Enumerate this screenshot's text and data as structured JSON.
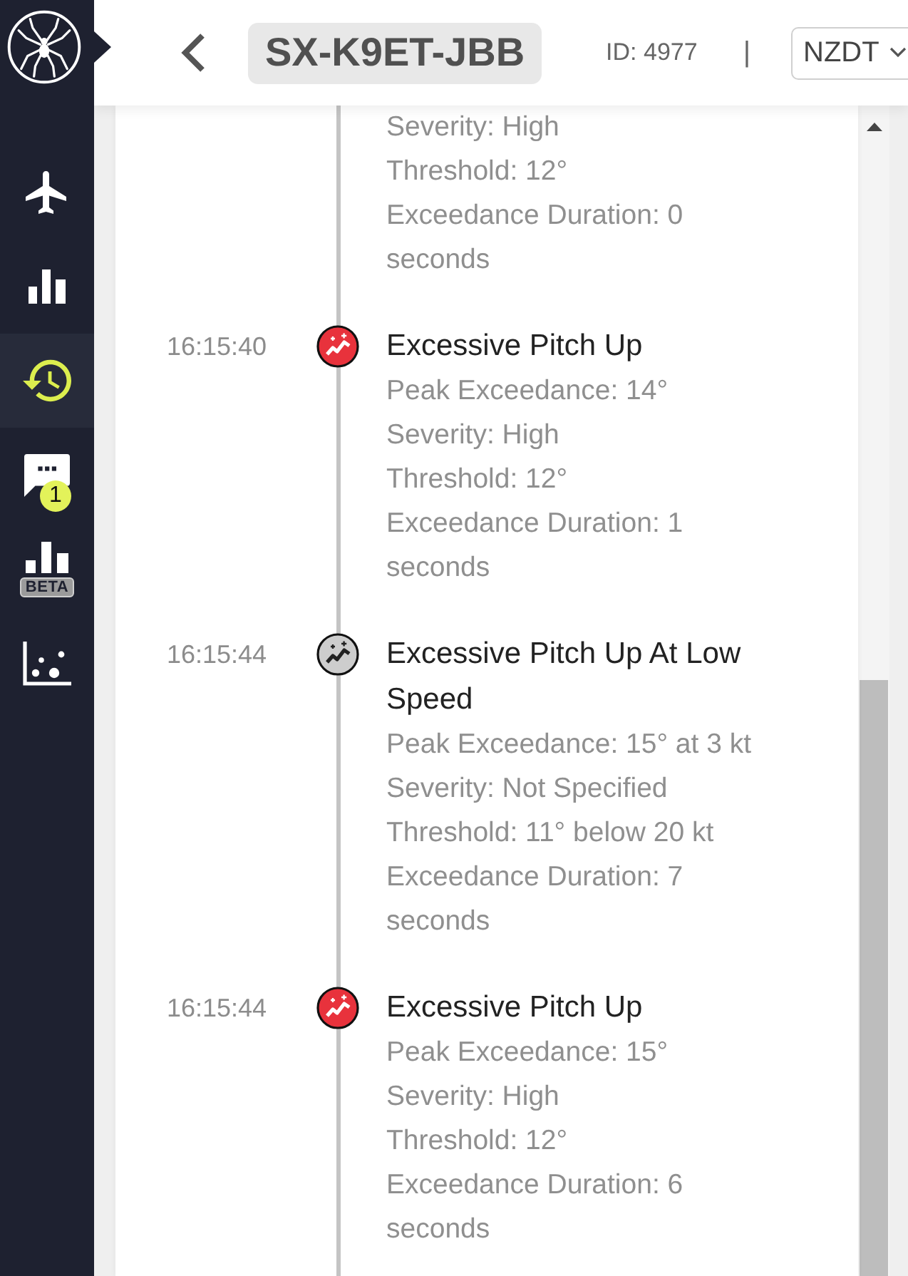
{
  "sidebar": {
    "items": [
      {
        "kind": "flights",
        "selected": false
      },
      {
        "kind": "charts",
        "selected": false
      },
      {
        "kind": "history",
        "selected": true
      },
      {
        "kind": "messages",
        "selected": false,
        "badge": "1"
      },
      {
        "kind": "charts-beta",
        "selected": false,
        "tag": "BETA"
      },
      {
        "kind": "scatter",
        "selected": false
      }
    ]
  },
  "header": {
    "title": "SX-K9ET-JBB",
    "id": "ID: 4977",
    "separator": "|",
    "timezone": "NZDT"
  },
  "timeline": {
    "events": [
      {
        "details": [
          "Severity: High",
          "Threshold: 12°",
          "Exceedance Duration: 0 seconds"
        ]
      },
      {
        "time": "16:15:40",
        "color": "#e8323c",
        "title": "Excessive Pitch Up",
        "details": [
          "Peak Exceedance: 14°",
          "Severity: High",
          "Threshold: 12°",
          "Exceedance Duration: 1 seconds"
        ]
      },
      {
        "time": "16:15:44",
        "color": "#cdcdcd",
        "title": "Excessive Pitch Up At Low Speed",
        "details": [
          "Peak Exceedance: 15° at 3 kt",
          "Severity: Not Specified",
          "Threshold: 11° below 20 kt",
          "Exceedance Duration: 7 seconds"
        ]
      },
      {
        "time": "16:15:44",
        "color": "#e8323c",
        "title": "Excessive Pitch Up",
        "details": [
          "Peak Exceedance: 15°",
          "Severity: High",
          "Threshold: 12°",
          "Exceedance Duration: 6 seconds"
        ]
      }
    ]
  }
}
